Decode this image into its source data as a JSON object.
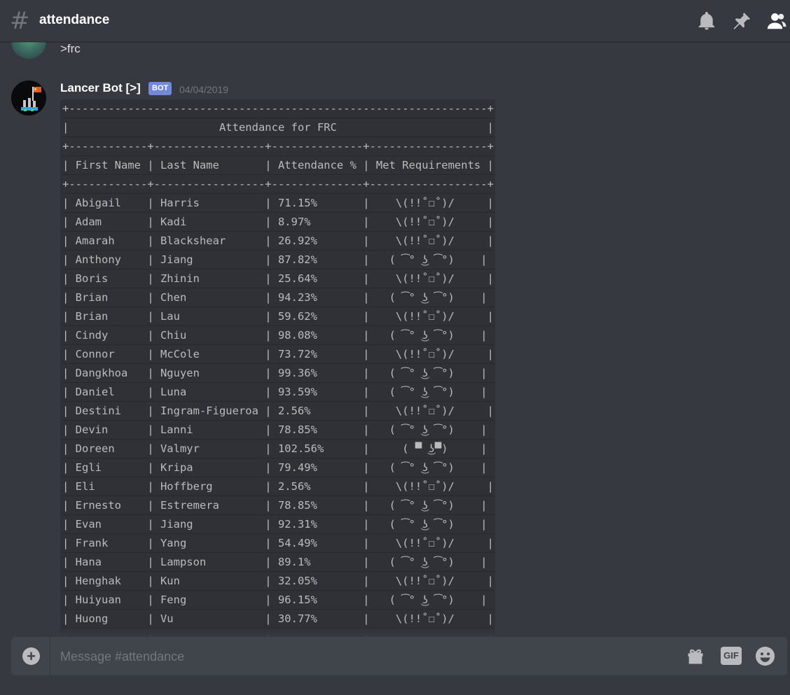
{
  "header": {
    "channel": "attendance",
    "icons": [
      "bell-icon",
      "pin-icon",
      "members-icon"
    ]
  },
  "previous_message": {
    "text": ">frc"
  },
  "message": {
    "author": "Lancer Bot [>]",
    "tag": "BOT",
    "timestamp": "04/04/2019"
  },
  "table": {
    "title": "Attendance for FRC",
    "headers": [
      "First Name",
      "Last Name",
      "Attendance %",
      "Met Requirements"
    ],
    "rows": [
      [
        "Abigail",
        "Harris",
        "71.15%",
        "\\(!!˚☐˚)/"
      ],
      [
        "Adam",
        "Kadi",
        "8.97%",
        "\\(!!˚☐˚)/"
      ],
      [
        "Amarah",
        "Blackshear",
        "26.92%",
        "\\(!!˚☐˚)/"
      ],
      [
        "Anthony",
        "Jiang",
        "87.82%",
        "( ͡° ͜ʖ ͡°)"
      ],
      [
        "Boris",
        "Zhinin",
        "25.64%",
        "\\(!!˚☐˚)/"
      ],
      [
        "Brian",
        "Chen",
        "94.23%",
        "( ͡° ͜ʖ ͡°)"
      ],
      [
        "Brian",
        "Lau",
        "59.62%",
        "\\(!!˚☐˚)/"
      ],
      [
        "Cindy",
        "Chiu",
        "98.08%",
        "( ͡° ͜ʖ ͡°)"
      ],
      [
        "Connor",
        "McCole",
        "73.72%",
        "\\(!!˚☐˚)/"
      ],
      [
        "Dangkhoa",
        "Nguyen",
        "99.36%",
        "( ͡° ͜ʖ ͡°)"
      ],
      [
        "Daniel",
        "Luna",
        "93.59%",
        "( ͡° ͜ʖ ͡°)"
      ],
      [
        "Destini",
        "Ingram-Figueroa",
        "2.56%",
        "\\(!!˚☐˚)/"
      ],
      [
        "Devin",
        "Lanni",
        "78.85%",
        "( ͡° ͜ʖ ͡°)"
      ],
      [
        "Doreen",
        "Valmyr",
        "102.56%",
        "( ▀ ͜ʖ▀)"
      ],
      [
        "Egli",
        "Kripa",
        "79.49%",
        "( ͡° ͜ʖ ͡°)"
      ],
      [
        "Eli",
        "Hoffberg",
        "2.56%",
        "\\(!!˚☐˚)/"
      ],
      [
        "Ernesto",
        "Estremera",
        "78.85%",
        "( ͡° ͜ʖ ͡°)"
      ],
      [
        "Evan",
        "Jiang",
        "92.31%",
        "( ͡° ͜ʖ ͡°)"
      ],
      [
        "Frank",
        "Yang",
        "54.49%",
        "\\(!!˚☐˚)/"
      ],
      [
        "Hana",
        "Lampson",
        "89.1%",
        "( ͡° ͜ʖ ͡°)"
      ],
      [
        "Henghak",
        "Kun",
        "32.05%",
        "\\(!!˚☐˚)/"
      ],
      [
        "Huiyuan",
        "Feng",
        "96.15%",
        "( ͡° ͜ʖ ͡°)"
      ],
      [
        "Huong",
        "Vu",
        "30.77%",
        "\\(!!˚☐˚)/"
      ]
    ]
  },
  "composer": {
    "placeholder": "Message #attendance",
    "gif_label": "GIF",
    "icons": [
      "add-icon",
      "gift-icon",
      "gif-icon",
      "emoji-icon"
    ]
  },
  "colors": {
    "background": "#36393f",
    "code_background": "#2f3136",
    "bot_tag": "#7289da",
    "composer": "#40444b"
  }
}
